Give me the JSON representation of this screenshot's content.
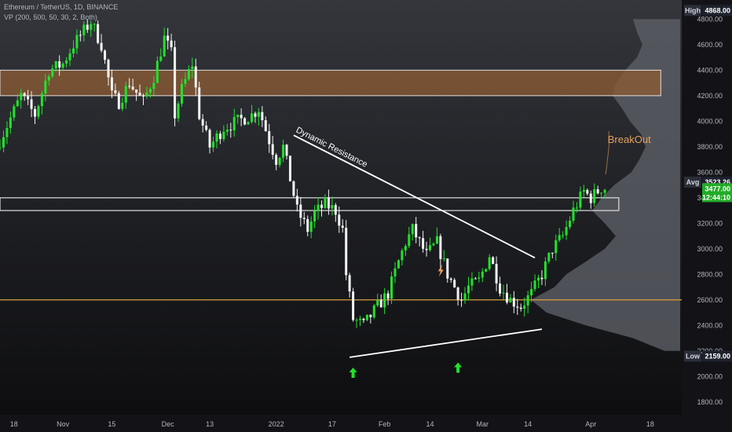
{
  "header": {
    "symbol_line": "Ethereum / TetherUS, 1D, BINANCE",
    "indicator_line": "VP (200, 500, 50, 30, 2, Both)"
  },
  "currency": "USDT",
  "colors": {
    "background": "#101013",
    "up": "#22e12c",
    "down": "#f2f2f2",
    "resistance_zone": "#8a5a34",
    "support_line": "#d9a13d",
    "volume_profile": "#5c5f66",
    "breakout_text": "#e6a15a",
    "arrow": "#22e12c",
    "last_price": "#22ab27"
  },
  "chart_data": {
    "type": "candlestick",
    "y_axis": {
      "range": [
        1700,
        4950
      ],
      "ticks": [
        1800,
        2000,
        2200,
        2400,
        2600,
        2800,
        3000,
        3200,
        3400,
        3600,
        3800,
        4000,
        4200,
        4400,
        4600,
        4800
      ],
      "tick_labels": [
        "1800.00",
        "2000.00",
        "2200.00",
        "2400.00",
        "2600.00",
        "2800.00",
        "3000.00",
        "3200.00",
        "3400.00",
        "3600.00",
        "3800.00",
        "4000.00",
        "4200.00",
        "4400.00",
        "4600.00",
        "4800.00"
      ]
    },
    "x_axis": {
      "range": [
        "2021-10-14",
        "2022-04-27"
      ],
      "ticks": [
        {
          "date": "2021-10-18",
          "label": "18"
        },
        {
          "date": "2021-11-01",
          "label": "Nov"
        },
        {
          "date": "2021-11-15",
          "label": "15"
        },
        {
          "date": "2021-12-01",
          "label": "Dec"
        },
        {
          "date": "2021-12-13",
          "label": "13"
        },
        {
          "date": "2022-01-01",
          "label": "2022"
        },
        {
          "date": "2022-01-17",
          "label": "17"
        },
        {
          "date": "2022-02-01",
          "label": "Feb"
        },
        {
          "date": "2022-02-14",
          "label": "14"
        },
        {
          "date": "2022-03-01",
          "label": "Mar"
        },
        {
          "date": "2022-03-14",
          "label": "14"
        },
        {
          "date": "2022-04-01",
          "label": "Apr"
        },
        {
          "date": "2022-04-18",
          "label": "18"
        }
      ]
    },
    "price_path": [
      [
        "2021-10-14",
        3790
      ],
      [
        "2021-10-21",
        4200
      ],
      [
        "2021-10-25",
        4050
      ],
      [
        "2021-10-29",
        4400
      ],
      [
        "2021-11-02",
        4450
      ],
      [
        "2021-11-05",
        4600
      ],
      [
        "2021-11-10",
        4780
      ],
      [
        "2021-11-13",
        4600
      ],
      [
        "2021-11-16",
        4200
      ],
      [
        "2021-11-18",
        4150
      ],
      [
        "2021-11-21",
        4300
      ],
      [
        "2021-11-25",
        4150
      ],
      [
        "2021-11-28",
        4350
      ],
      [
        "2021-12-01",
        4650
      ],
      [
        "2021-12-03",
        4530
      ],
      [
        "2021-12-04",
        4050
      ],
      [
        "2021-12-06",
        4250
      ],
      [
        "2021-12-09",
        4450
      ],
      [
        "2021-12-11",
        4050
      ],
      [
        "2021-12-14",
        3800
      ],
      [
        "2021-12-18",
        3950
      ],
      [
        "2021-12-22",
        4000
      ],
      [
        "2021-12-26",
        4050
      ],
      [
        "2021-12-28",
        4100
      ],
      [
        "2021-12-31",
        3850
      ],
      [
        "2022-01-02",
        3700
      ],
      [
        "2022-01-04",
        3800
      ],
      [
        "2022-01-06",
        3550
      ],
      [
        "2022-01-08",
        3300
      ],
      [
        "2022-01-11",
        3150
      ],
      [
        "2022-01-13",
        3280
      ],
      [
        "2022-01-16",
        3350
      ],
      [
        "2022-01-19",
        3300
      ],
      [
        "2022-01-21",
        3150
      ],
      [
        "2022-01-22",
        2800
      ],
      [
        "2022-01-24",
        2450
      ],
      [
        "2022-01-27",
        2400
      ],
      [
        "2022-01-31",
        2550
      ],
      [
        "2022-02-03",
        2650
      ],
      [
        "2022-02-06",
        2900
      ],
      [
        "2022-02-08",
        3050
      ],
      [
        "2022-02-10",
        3150
      ],
      [
        "2022-02-12",
        3050
      ],
      [
        "2022-02-14",
        2950
      ],
      [
        "2022-02-17",
        3050
      ],
      [
        "2022-02-20",
        2800
      ],
      [
        "2022-02-24",
        2600
      ],
      [
        "2022-02-26",
        2700
      ],
      [
        "2022-03-01",
        2750
      ],
      [
        "2022-03-04",
        2950
      ],
      [
        "2022-03-07",
        2700
      ],
      [
        "2022-03-10",
        2600
      ],
      [
        "2022-03-13",
        2550
      ],
      [
        "2022-03-16",
        2650
      ],
      [
        "2022-03-19",
        2800
      ],
      [
        "2022-03-22",
        3000
      ],
      [
        "2022-03-25",
        3100
      ],
      [
        "2022-03-28",
        3300
      ],
      [
        "2022-03-31",
        3450
      ],
      [
        "2022-04-02",
        3400
      ],
      [
        "2022-04-05",
        3477
      ]
    ],
    "levels": {
      "high": {
        "label": "High",
        "value": "4868.00"
      },
      "avg": {
        "label": "Avg",
        "value": "3523.26"
      },
      "last": {
        "value": "3477.00",
        "countdown": "12:44:10"
      },
      "low": {
        "label": "Low",
        "value": "2159.00"
      }
    },
    "zones": [
      {
        "name": "resistance-zone",
        "from": 4200,
        "to": 4400,
        "start": "2021-10-14",
        "end": "2022-04-21"
      },
      {
        "name": "support-resistance-box",
        "from": 3300,
        "to": 3400,
        "start": "2021-10-14",
        "end": "2022-04-09"
      }
    ],
    "horizontal_lines": [
      {
        "name": "support-line",
        "value": 2600
      }
    ],
    "trendlines": [
      {
        "name": "dynamic-resistance",
        "label": "Dynamic Resistance",
        "from": [
          "2022-01-06",
          3890
        ],
        "to": [
          "2022-03-16",
          2930
        ]
      },
      {
        "name": "rising-support",
        "from": [
          "2022-01-22",
          2150
        ],
        "to": [
          "2022-03-18",
          2370
        ]
      }
    ],
    "annotations": [
      {
        "name": "breakout-label",
        "text": "BreakOut",
        "date": "2022-04-12",
        "price": 3830
      },
      {
        "name": "arrow-up-1",
        "date": "2022-01-23",
        "price": 2020
      },
      {
        "name": "arrow-up-2",
        "date": "2022-02-22",
        "price": 2060
      },
      {
        "name": "lightning-icon",
        "date": "2022-02-17",
        "price": 2830
      }
    ]
  }
}
